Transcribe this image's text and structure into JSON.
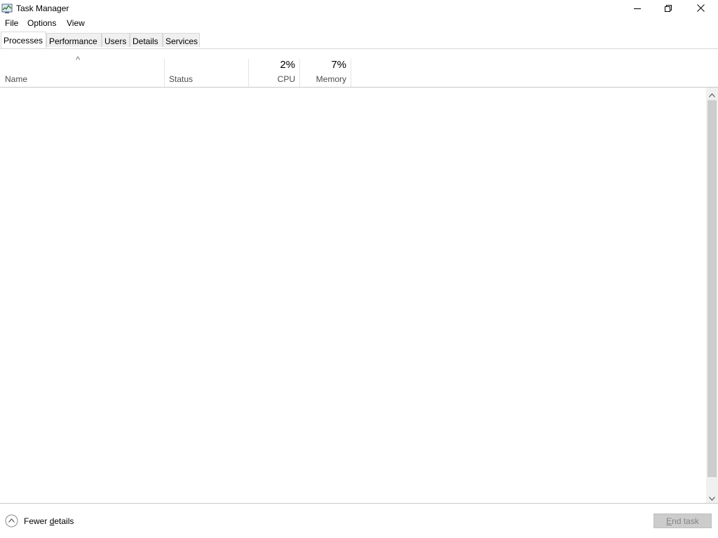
{
  "window": {
    "title": "Task Manager",
    "icon": "task-manager-icon",
    "controls": [
      "minimize-icon",
      "restore-icon",
      "close-icon"
    ]
  },
  "menu": {
    "items": [
      {
        "label": "File"
      },
      {
        "label": "Options"
      },
      {
        "label": "View"
      }
    ]
  },
  "tabs": [
    {
      "label": "Processes",
      "active": true
    },
    {
      "label": "Performance",
      "active": false
    },
    {
      "label": "Users",
      "active": false
    },
    {
      "label": "Details",
      "active": false
    },
    {
      "label": "Services",
      "active": false
    }
  ],
  "columns": {
    "sort_indicator": "^",
    "name": {
      "label": "Name"
    },
    "status": {
      "label": "Status"
    },
    "cpu": {
      "label": "CPU",
      "value": "2%"
    },
    "memory": {
      "label": "Memory",
      "value": "7%"
    }
  },
  "footer": {
    "fewer_details_prefix": "Fewer ",
    "fewer_details_underlined": "d",
    "fewer_details_suffix": "etails",
    "end_task_underlined": "E",
    "end_task_suffix": "nd task"
  },
  "colors": {
    "tab_inactive_bg": "#f0f0f0",
    "button_disabled_bg": "#cccccc",
    "scrollbar_thumb": "#cdcdcd"
  }
}
